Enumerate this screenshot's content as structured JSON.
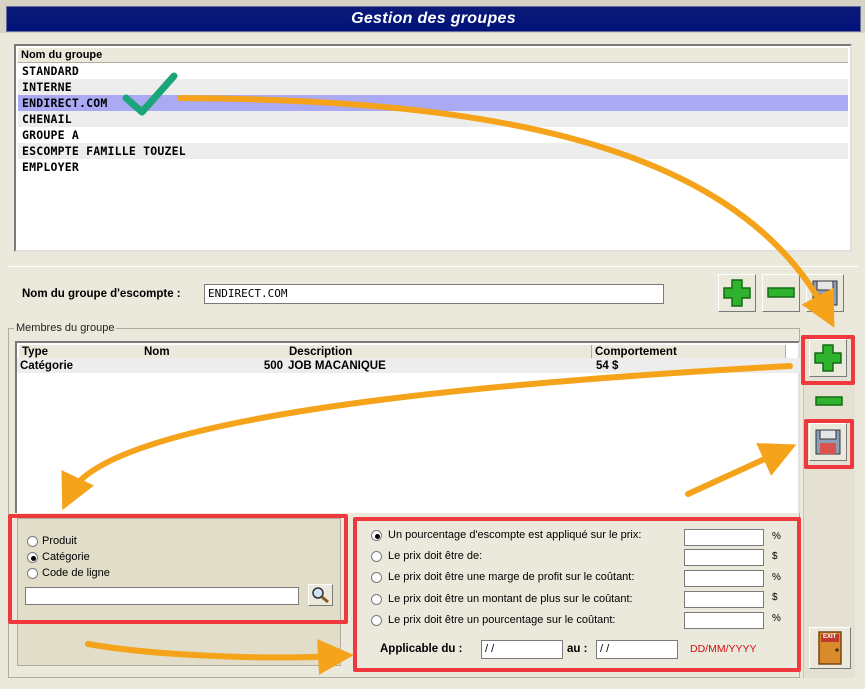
{
  "window": {
    "title": "Gestion des groupes"
  },
  "groups": {
    "column_header": "Nom du groupe",
    "items": [
      "STANDARD",
      "INTERNE",
      "ENDIRECT.COM",
      "CHENAIL",
      "GROUPE A",
      "ESCOMPTE FAMILLE TOUZEL",
      "EMPLOYER"
    ],
    "selected": "ENDIRECT.COM"
  },
  "group_name": {
    "label": "Nom du groupe d'escompte :",
    "value": "ENDIRECT.COM"
  },
  "members": {
    "legend": "Membres du groupe",
    "columns": [
      "Type",
      "Nom",
      "Description",
      "Comportement"
    ],
    "rows": [
      {
        "type": "Catégorie",
        "nom": "500",
        "description": "JOB MACANIQUE",
        "comportement": "54 $"
      }
    ]
  },
  "member_type": {
    "options": [
      "Produit",
      "Catégorie",
      "Code de ligne"
    ],
    "selected": "Catégorie",
    "search_value": ""
  },
  "pricing": {
    "options": [
      {
        "label": "Un pourcentage d'escompte est appliqué sur le prix:",
        "unit": "%",
        "value": ""
      },
      {
        "label": "Le prix doit être de:",
        "unit": "$",
        "value": ""
      },
      {
        "label": "Le prix doit être une marge de profit sur le coûtant:",
        "unit": "%",
        "value": ""
      },
      {
        "label": "Le prix doit être un montant de plus sur le coûtant:",
        "unit": "$",
        "value": ""
      },
      {
        "label": "Le prix doit être un pourcentage sur le coûtant:",
        "unit": "%",
        "value": ""
      }
    ],
    "selected_index": 0,
    "applicable_label": "Applicable du :",
    "from_value": " / /",
    "to_label": "au :",
    "to_value": " / /",
    "date_format": "DD/MM/YYYY"
  },
  "icons": {
    "add": "plus-icon",
    "remove": "minus-icon",
    "save": "floppy-disk-icon",
    "search": "magnifier-icon",
    "exit": "exit-door-icon",
    "check": "checkmark-icon"
  },
  "colors": {
    "title_bar": "#00137a",
    "selection": "#a9a9f4",
    "plus": "#2fb32f",
    "highlight": "#f0393f",
    "arrow": "#f5a31a",
    "date_hint": "#d01010"
  },
  "exit_label": "EXIT"
}
